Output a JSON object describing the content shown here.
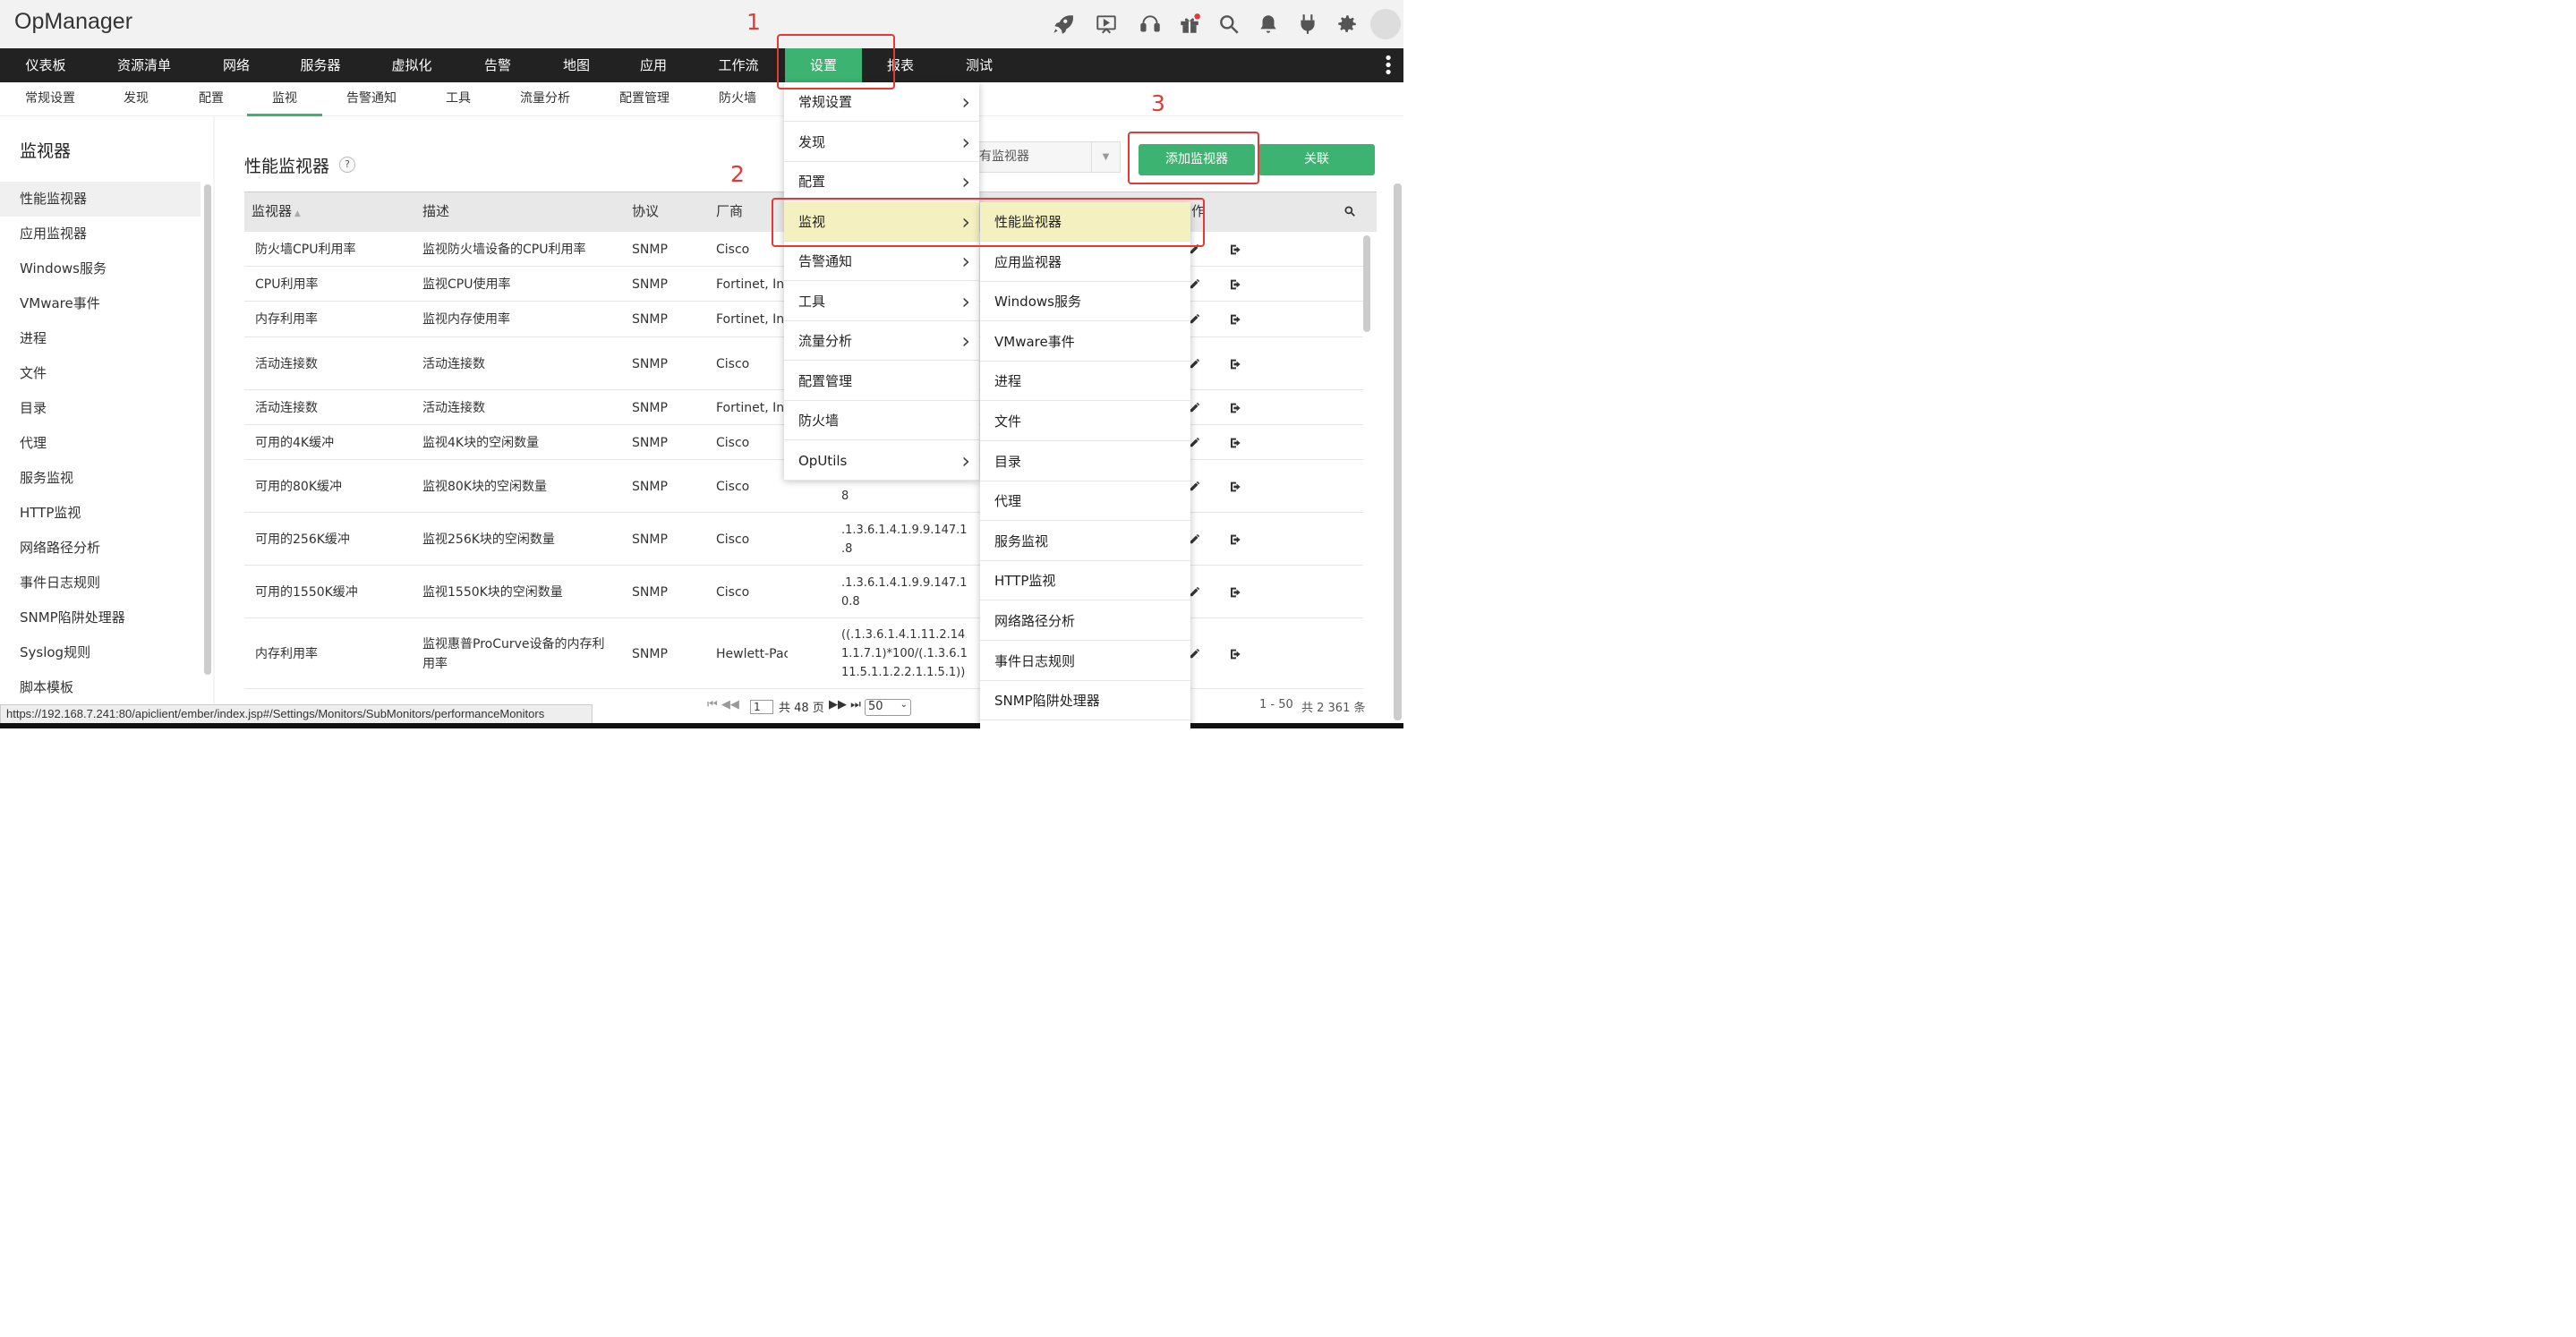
{
  "app_title": "OpManager",
  "header_icons": [
    "rocket-icon",
    "presentation-icon",
    "headset-icon",
    "gift-icon",
    "search-icon",
    "bell-icon",
    "plug-icon",
    "gear-icon"
  ],
  "main_nav": [
    {
      "label": "仪表板"
    },
    {
      "label": "资源清单"
    },
    {
      "label": "网络"
    },
    {
      "label": "服务器"
    },
    {
      "label": "虚拟化"
    },
    {
      "label": "告警"
    },
    {
      "label": "地图"
    },
    {
      "label": "应用"
    },
    {
      "label": "工作流"
    },
    {
      "label": "设置",
      "active": true
    },
    {
      "label": "报表"
    },
    {
      "label": "测试"
    }
  ],
  "sub_nav": [
    {
      "label": "常规设置"
    },
    {
      "label": "发现"
    },
    {
      "label": "配置"
    },
    {
      "label": "监视",
      "active": true
    },
    {
      "label": "告警通知"
    },
    {
      "label": "工具"
    },
    {
      "label": "流量分析"
    },
    {
      "label": "配置管理"
    },
    {
      "label": "防火墙"
    }
  ],
  "sidebar": {
    "title": "监视器",
    "items": [
      "性能监视器",
      "应用监视器",
      "Windows服务",
      "VMware事件",
      "进程",
      "文件",
      "目录",
      "代理",
      "服务监视",
      "HTTP监视",
      "网络路径分析",
      "事件日志规则",
      "SNMP陷阱处理器",
      "Syslog规则",
      "脚本模板"
    ]
  },
  "page": {
    "title": "性能监视器",
    "help": "?",
    "filter_value": "有监视器",
    "add_button": "添加监视器",
    "associate_button": "关联"
  },
  "table": {
    "columns": [
      "监视器",
      "描述",
      "协议",
      "厂商",
      "作"
    ],
    "rows": [
      {
        "name": "防火墙CPU利用率",
        "desc": "监视防火墙设备的CPU利用率",
        "proto": "SNMP",
        "vendor": "Cisco",
        "oid": ""
      },
      {
        "name": "CPU利用率",
        "desc": "监视CPU使用率",
        "proto": "SNMP",
        "vendor": "Fortinet, Inc",
        "oid": ""
      },
      {
        "name": "内存利用率",
        "desc": "监视内存使用率",
        "proto": "SNMP",
        "vendor": "Fortinet, Inc",
        "oid": ""
      },
      {
        "name": "活动连接数",
        "desc": "活动连接数",
        "proto": "SNMP",
        "vendor": "Cisco",
        "oid": ""
      },
      {
        "name": "活动连接数",
        "desc": "活动连接数",
        "proto": "SNMP",
        "vendor": "Fortinet, Inc",
        "oid": ""
      },
      {
        "name": "可用的4K缓冲",
        "desc": "监视4K块的空闲数量",
        "proto": "SNMP",
        "vendor": "Cisco",
        "oid": ""
      },
      {
        "name": "可用的80K缓冲",
        "desc": "监视80K块的空闲数量",
        "proto": "SNMP",
        "vendor": "Cisco",
        "oid": ".1.3.6.1.4.1.9.9.147.1.2.2.\n8"
      },
      {
        "name": "可用的256K缓冲",
        "desc": "监视256K块的空闲数量",
        "proto": "SNMP",
        "vendor": "Cisco",
        "oid": ".1.3.6.1.4.1.9.9.147.1.2.2.\n.8"
      },
      {
        "name": "可用的1550K缓冲",
        "desc": "监视1550K块的空闲数量",
        "proto": "SNMP",
        "vendor": "Cisco",
        "oid": ".1.3.6.1.4.1.9.9.147.1.2.2.\n0.8"
      },
      {
        "name": "内存利用率",
        "desc": "监视惠普ProCurve设备的内存利\n用率",
        "proto": "SNMP",
        "vendor": "Hewlett-Packard",
        "oid": "((.1.3.6.1.4.1.11.2.14.11.5\n1.1.7.1)*100/(.1.3.6.1.4.1\n11.5.1.1.2.2.1.1.5.1))"
      }
    ]
  },
  "pager": {
    "page": "1",
    "total_pages": "共 48 页",
    "per_page": "50",
    "summary": "1 - 50",
    "total": "共 2 361 条"
  },
  "status_url": "https://192.168.7.241:80/apiclient/ember/index.jsp#/Settings/Monitors/SubMonitors/performanceMonitors",
  "menu_settings": [
    {
      "label": "常规设置",
      "sub": true
    },
    {
      "label": "发现",
      "sub": true
    },
    {
      "label": "配置",
      "sub": true
    },
    {
      "label": "监视",
      "sub": true,
      "hl": true
    },
    {
      "label": "告警通知",
      "sub": true
    },
    {
      "label": "工具",
      "sub": true
    },
    {
      "label": "流量分析",
      "sub": true
    },
    {
      "label": "配置管理",
      "sub": false
    },
    {
      "label": "防火墙",
      "sub": false
    },
    {
      "label": "OpUtils",
      "sub": true
    }
  ],
  "menu_monitor": [
    "性能监视器",
    "应用监视器",
    "Windows服务",
    "VMware事件",
    "进程",
    "文件",
    "目录",
    "代理",
    "服务监视",
    "HTTP监视",
    "网络路径分析",
    "事件日志规则",
    "SNMP陷阱处理器"
  ],
  "annotations": [
    "1",
    "2",
    "3"
  ]
}
